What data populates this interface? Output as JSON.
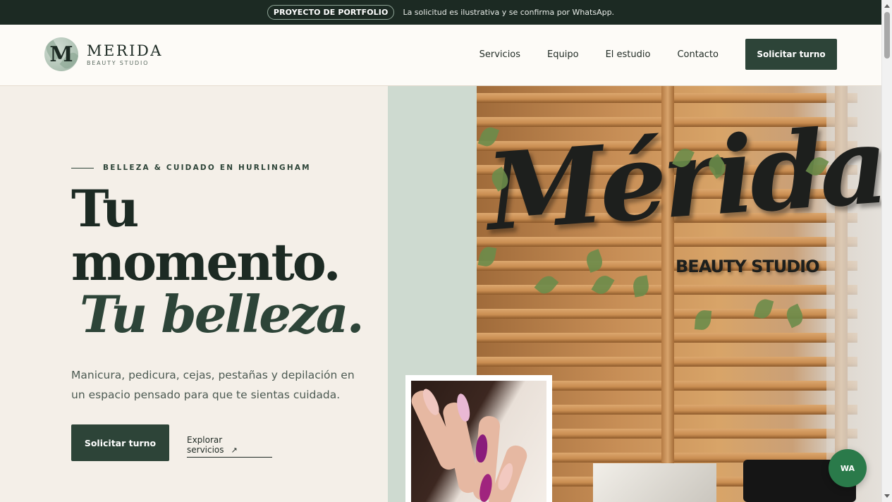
{
  "announcement": {
    "badge": "PROYECTO DE PORTFOLIO",
    "message": "La solicitud es ilustrativa y se confirma por WhatsApp."
  },
  "header": {
    "logo_letter": "M",
    "brand_name": "MERIDA",
    "brand_sub": "BEAUTY STUDIO",
    "nav": [
      "Servicios",
      "Equipo",
      "El estudio",
      "Contacto"
    ],
    "cta": "Solicitar turno"
  },
  "hero": {
    "eyebrow": "BELLEZA & CUIDADO EN HURLINGHAM",
    "headline_line1": "Tu",
    "headline_line2": "momento.",
    "headline_line3": "Tu belleza.",
    "lead": "Manicura, pedicura, cejas, pestañas y depilación en un espacio pensado para que te sientas cuidada.",
    "primary_button": "Solicitar turno",
    "secondary_link": "Explorar servicios",
    "secondary_arrow": "↗"
  },
  "photo": {
    "sign_script": "Mérida",
    "sign_sub": "BEAUTY STUDIO"
  },
  "floating": {
    "whatsapp_label": "WA",
    "whatsapp_color": "#2a7a4a"
  },
  "colors": {
    "topbar": "#1c2a23",
    "accent": "#2d4438",
    "cream": "#f4efe8",
    "sage": "#cedad0"
  }
}
